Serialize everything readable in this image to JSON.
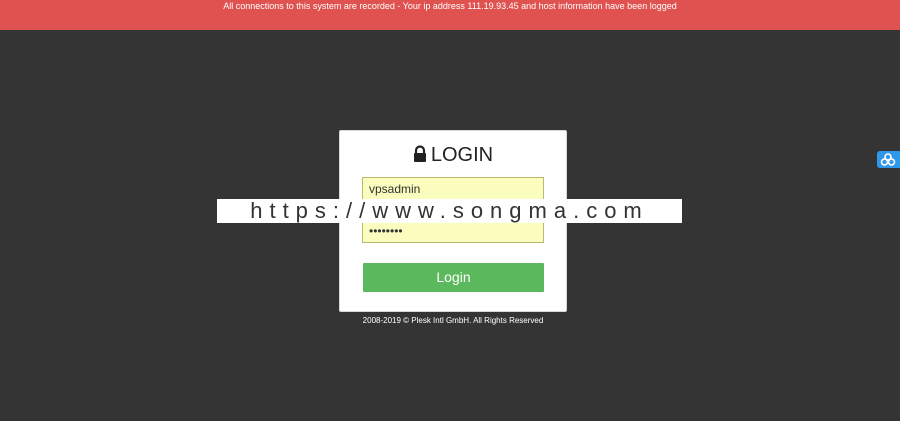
{
  "banner": {
    "text": "All connections to this system are recorded - Your ip address 111.19.93.45 and host information have been logged"
  },
  "login": {
    "title": "LOGIN",
    "username_value": "vpsadmin",
    "password_value": "12345678",
    "button_label": "Login"
  },
  "footer": {
    "copyright": "2008-2019 © Plesk Intl GmbH. All Rights Reserved"
  },
  "watermark": {
    "text": "https://www.songma.com"
  },
  "icons": {
    "title_icon": "lock-icon",
    "side_widget_icon": "share-icon"
  },
  "colors": {
    "banner": "#e0524f",
    "background": "#343434",
    "button": "#5cb85c",
    "field_bg": "#fafdbe",
    "side_widget": "#2f98e9"
  }
}
